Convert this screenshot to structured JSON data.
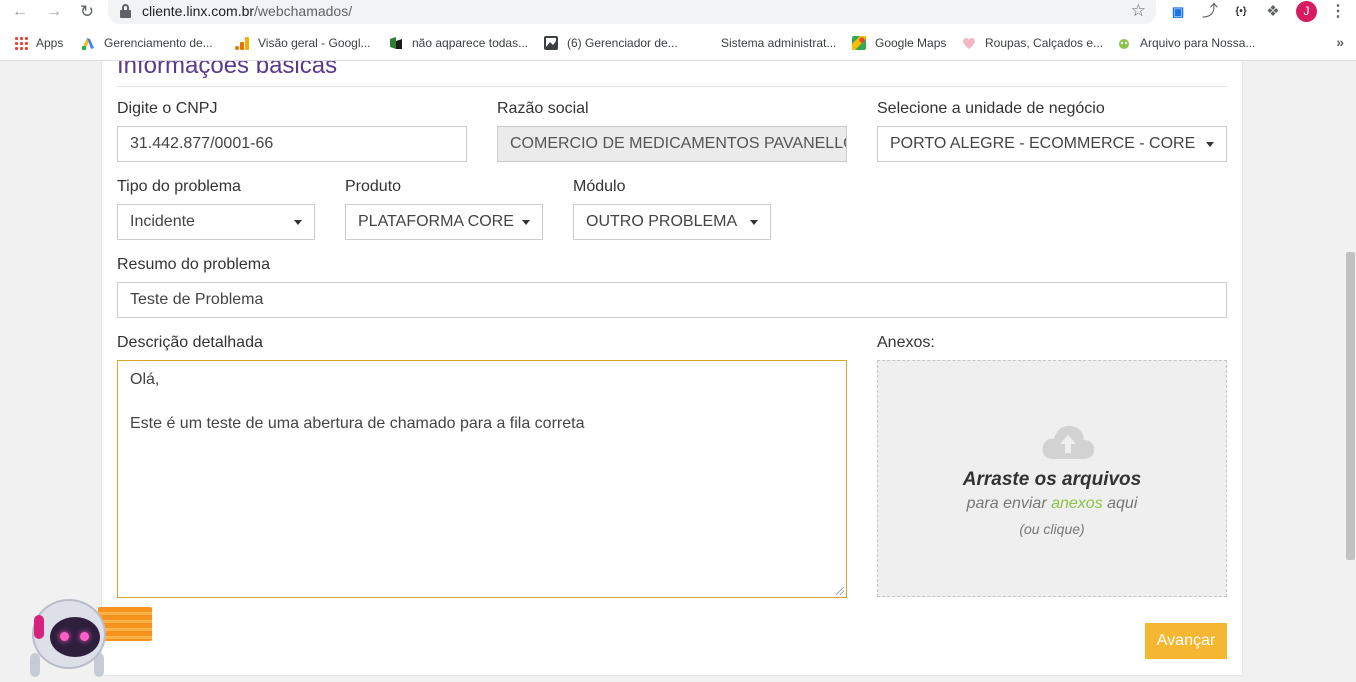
{
  "browser": {
    "url_host": "cliente.linx.com.br",
    "url_path": "/webchamados/",
    "profile_initial": "J",
    "extensions": [
      "translate-icon",
      "fork-icon",
      "json-icon",
      "puzzle-icon"
    ]
  },
  "bookmarks": [
    {
      "label": "Apps",
      "icon": "apps-grid-icon"
    },
    {
      "label": "Gerenciamento de...",
      "icon": "google-ads-icon"
    },
    {
      "label": "Visão geral - Googl...",
      "icon": "analytics-icon"
    },
    {
      "label": "não aqparece todas...",
      "icon": "bookmark-icon"
    },
    {
      "label": "(6) Gerenciador de...",
      "icon": "image-icon"
    },
    {
      "label": "Sistema administrat...",
      "icon": ""
    },
    {
      "label": "Google Maps",
      "icon": "maps-icon"
    },
    {
      "label": "Roupas, Calçados e...",
      "icon": "heart-icon"
    },
    {
      "label": "Arquivo para Nossa...",
      "icon": "file-icon"
    }
  ],
  "form": {
    "section_title": "Informações básicas",
    "cnpj": {
      "label": "Digite o CNPJ",
      "value": "31.442.877/0001-66"
    },
    "razao": {
      "label": "Razão social",
      "value": "COMERCIO DE MEDICAMENTOS PAVANELLO LTDA"
    },
    "unidade": {
      "label": "Selecione a unidade de negócio",
      "value": "PORTO ALEGRE - ECOMMERCE - CORE"
    },
    "tipo": {
      "label": "Tipo do problema",
      "value": "Incidente"
    },
    "produto": {
      "label": "Produto",
      "value": "PLATAFORMA CORE"
    },
    "modulo": {
      "label": "Módulo",
      "value": "OUTRO PROBLEMA"
    },
    "resumo": {
      "label": "Resumo do problema",
      "value": "Teste de Problema"
    },
    "descricao": {
      "label": "Descrição detalhada",
      "line1": "Olá,",
      "line2": "Este é um teste de uma abertura de chamado para a fila correta"
    },
    "anexos": {
      "label": "Anexos:",
      "title": "Arraste os arquivos",
      "sub_prefix": "para enviar ",
      "sub_accent": "anexos",
      "sub_suffix": " aqui",
      "hint": "(ou clique)"
    },
    "submit_label": "Avançar"
  },
  "colors": {
    "accent_purple": "#5a3a8a",
    "button_yellow": "#f5b731",
    "focus_border": "#d4a72c",
    "link_green": "#8bc34a"
  }
}
